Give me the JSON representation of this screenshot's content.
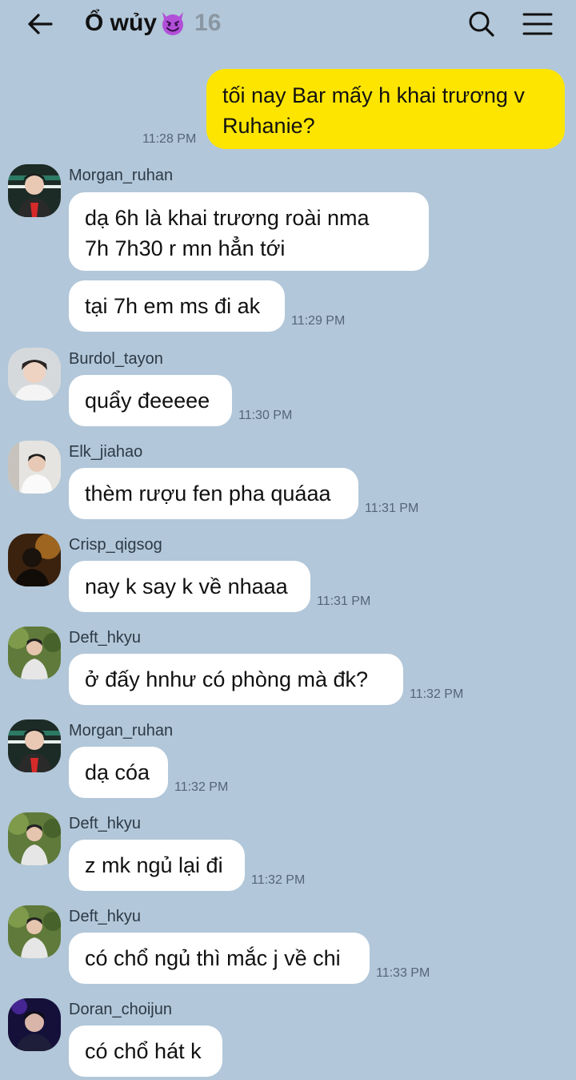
{
  "header": {
    "title": "Ổ wủy",
    "member_count": "16",
    "back_icon": "back-arrow-icon",
    "search_icon": "search-icon",
    "menu_icon": "hamburger-menu-icon",
    "title_emoji": "smiling-devil-emoji"
  },
  "colors": {
    "background": "#b2c7d9",
    "outgoing_bubble": "#fee500",
    "incoming_bubble": "#ffffff",
    "timestamp": "#55657a"
  },
  "messages": [
    {
      "from": "me",
      "lines": [
        "tối nay Bar mấy h khai trương v",
        "Ruhanie?"
      ],
      "time": "11:28 PM"
    },
    {
      "from": "Morgan_ruhan",
      "lines": [
        "dạ 6h là khai trương roài nma",
        "7h 7h30 r mn hẳn tới"
      ],
      "time": ""
    },
    {
      "from": "Morgan_ruhan",
      "lines": [
        "tại 7h em ms đi ak"
      ],
      "time": "11:29 PM"
    },
    {
      "from": "Burdol_tayon",
      "lines": [
        "quẩy đeeeee"
      ],
      "time": "11:30 PM"
    },
    {
      "from": "Elk_jiahao",
      "lines": [
        "thèm rượu fen pha quáaa"
      ],
      "time": "11:31 PM"
    },
    {
      "from": "Crisp_qigsog",
      "lines": [
        "nay k say k về nhaaa"
      ],
      "time": "11:31 PM"
    },
    {
      "from": "Deft_hkyu",
      "lines": [
        "ở đấy hnhư có phòng mà đk?"
      ],
      "time": "11:32 PM"
    },
    {
      "from": "Morgan_ruhan",
      "lines": [
        "dạ cóa"
      ],
      "time": "11:32 PM"
    },
    {
      "from": "Deft_hkyu",
      "lines": [
        "z mk ngủ lại đi"
      ],
      "time": "11:32 PM"
    },
    {
      "from": "Deft_hkyu",
      "lines": [
        "có chổ ngủ thì mắc j về chi"
      ],
      "time": "11:33 PM"
    },
    {
      "from": "Doran_choijun",
      "lines": [
        "có chổ hát k"
      ],
      "time": ""
    }
  ]
}
